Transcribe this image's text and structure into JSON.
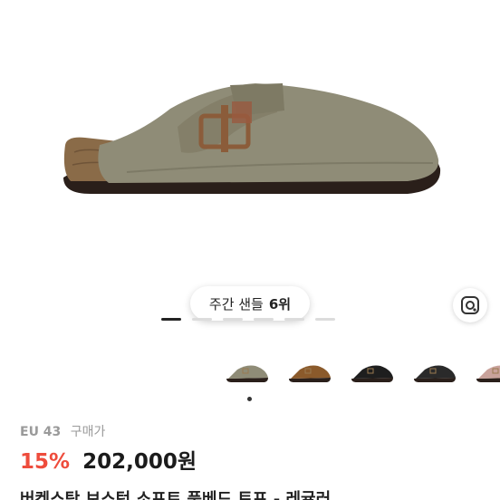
{
  "rank_badge": {
    "label": "주간 샌들",
    "rank": "6위"
  },
  "product": {
    "size_label": "EU 43",
    "purchase_label": "구매가",
    "discount": "15%",
    "price": "202,000원",
    "title": "버켄스탁 보스턴 소프트 풋베드 토프 - 레귤러"
  },
  "carousel": {
    "current": 1,
    "total": 6
  },
  "thumbnails": [
    {
      "name": "taupe-thumbnail",
      "color": "#8f8c77"
    },
    {
      "name": "tan-thumbnail",
      "color": "#8b5a2b"
    },
    {
      "name": "black-thumbnail",
      "color": "#1e1e1e"
    },
    {
      "name": "black-oiled-thumbnail",
      "color": "#2a2a2a"
    },
    {
      "name": "pink-thumbnail",
      "color": "#c9a29b"
    }
  ],
  "colors": {
    "discount": "#ee4c3c",
    "upper": "#8f8c77",
    "cork": "#8a6b48",
    "sole": "#2a1f1a"
  }
}
